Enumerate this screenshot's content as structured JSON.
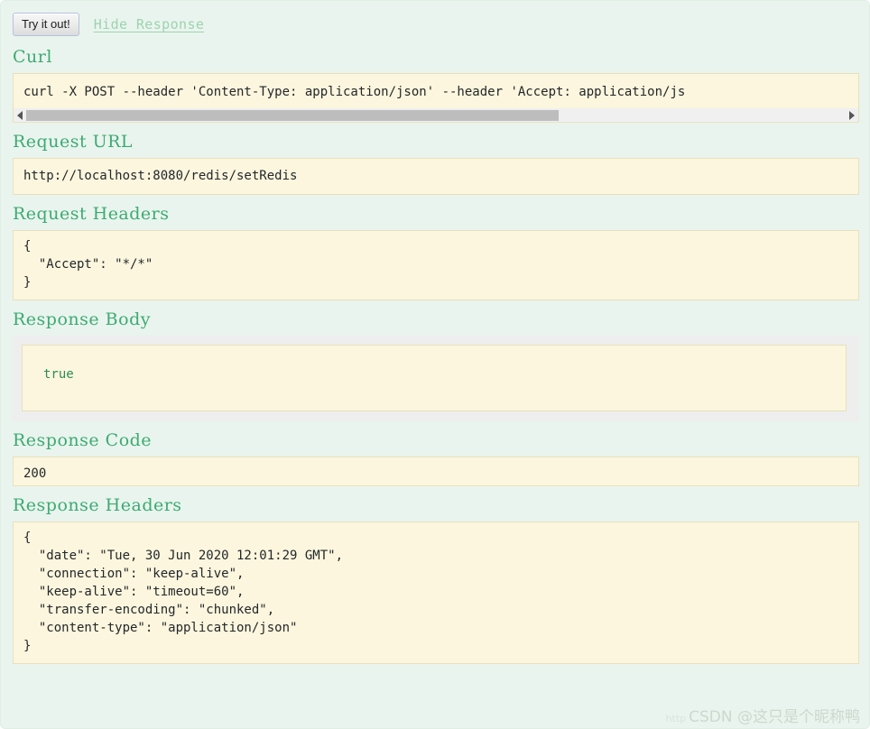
{
  "toolbar": {
    "submit_label": "Try it out!",
    "hide_response_label": "Hide Response"
  },
  "sections": {
    "curl": {
      "title": "Curl",
      "command": "curl -X POST --header 'Content-Type: application/json' --header 'Accept: application/js"
    },
    "request_url": {
      "title": "Request URL",
      "value": "http://localhost:8080/redis/setRedis"
    },
    "request_headers": {
      "title": "Request Headers",
      "value": "{\n  \"Accept\": \"*/*\"\n}"
    },
    "response_body": {
      "title": "Response Body",
      "value": "true"
    },
    "response_code": {
      "title": "Response Code",
      "value": "200"
    },
    "response_headers": {
      "title": "Response Headers",
      "value": "{\n  \"date\": \"Tue, 30 Jun 2020 12:01:29 GMT\",\n  \"connection\": \"keep-alive\",\n  \"keep-alive\": \"timeout=60\",\n  \"transfer-encoding\": \"chunked\",\n  \"content-type\": \"application/json\"\n}"
    }
  },
  "watermark": {
    "url": "http",
    "text": "CSDN @这只是个昵称鸭"
  },
  "colors": {
    "background": "#eaf4ee",
    "panel": "#fbf6dd",
    "panel_border": "#e8e0bd",
    "heading": "#3cab72",
    "link": "#9bd4ae",
    "response_body_text": "#2e8b57"
  }
}
